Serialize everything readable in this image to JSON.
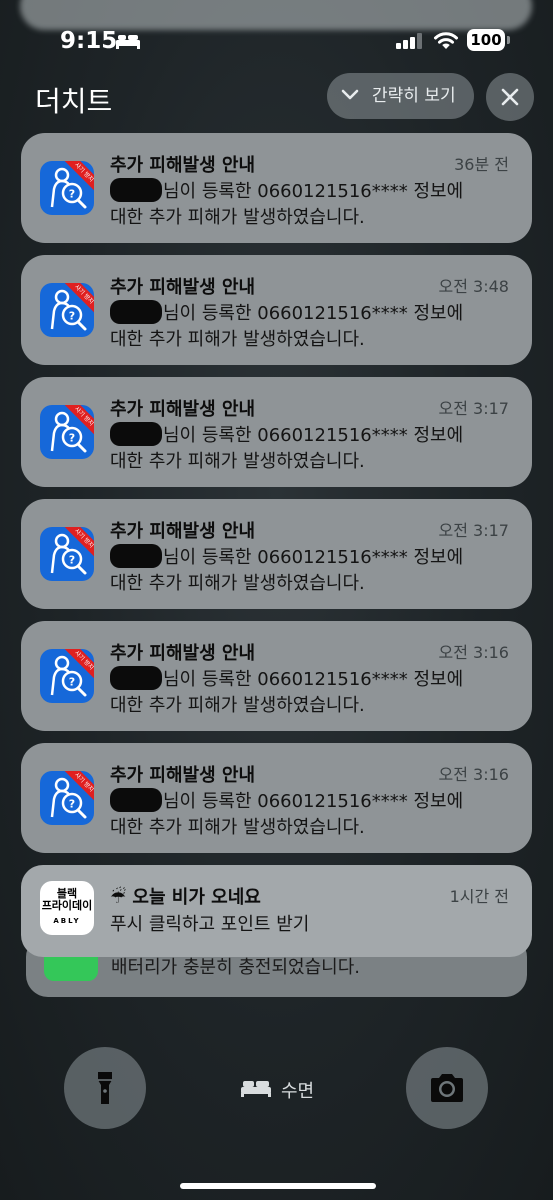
{
  "status_bar": {
    "time": "9:15",
    "battery": "100"
  },
  "group": {
    "app_name": "더치트",
    "collapse_label": "간략히 보기"
  },
  "notifications": [
    {
      "title": "추가 피해발생 안내",
      "time": "36분 전",
      "line1": "님이 등록한 0660121516**** 정보에",
      "line2": "대한 추가 피해가 발생하였습니다."
    },
    {
      "title": "추가 피해발생 안내",
      "time": "오전 3:48",
      "line1": "님이 등록한 0660121516**** 정보에",
      "line2": "대한 추가 피해가 발생하였습니다."
    },
    {
      "title": "추가 피해발생 안내",
      "time": "오전 3:17",
      "line1": "님이 등록한 0660121516**** 정보에",
      "line2": "대한 추가 피해가 발생하였습니다."
    },
    {
      "title": "추가 피해발생 안내",
      "time": "오전 3:17",
      "line1": "님이 등록한 0660121516**** 정보에",
      "line2": "대한 추가 피해가 발생하였습니다."
    },
    {
      "title": "추가 피해발생 안내",
      "time": "오전 3:16",
      "line1": "님이 등록한 0660121516**** 정보에",
      "line2": "대한 추가 피해가 발생하였습니다."
    },
    {
      "title": "추가 피해발생 안내",
      "time": "오전 3:16",
      "line1": "님이 등록한 0660121516**** 정보에",
      "line2": "대한 추가 피해가 발생하였습니다."
    }
  ],
  "icon_badge": "사기 방지",
  "ably": {
    "icon_line1": "블랙",
    "icon_line2": "프라이데이",
    "icon_line3": "ABLY",
    "title": "☔ 오늘 비가 오네요",
    "body": "푸시 클릭하고 포인트 받기",
    "time": "1시간 전"
  },
  "stacked": {
    "body": "배터리가 충분히 충전되었습니다."
  },
  "focus_mode": {
    "label": "수면"
  },
  "colors": {
    "app_icon": "#1668d9",
    "badge": "#e02020",
    "card": "#8f9497"
  }
}
